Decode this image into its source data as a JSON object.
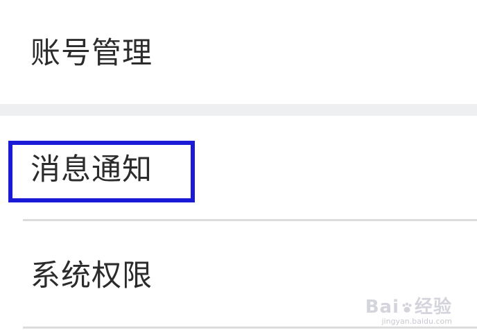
{
  "settings": {
    "items": [
      {
        "label": "账号管理"
      },
      {
        "label": "消息通知"
      },
      {
        "label": "系统权限"
      }
    ],
    "highlighted_index": 1
  },
  "watermark": {
    "brand_left": "Bai",
    "brand_right": "经验",
    "url": "jingyan.baidu.com"
  },
  "colors": {
    "highlight_border": "#1a1ad6",
    "group_gap": "#eeeff1",
    "divider": "#dcdcdc",
    "text": "#2b2b2b"
  }
}
